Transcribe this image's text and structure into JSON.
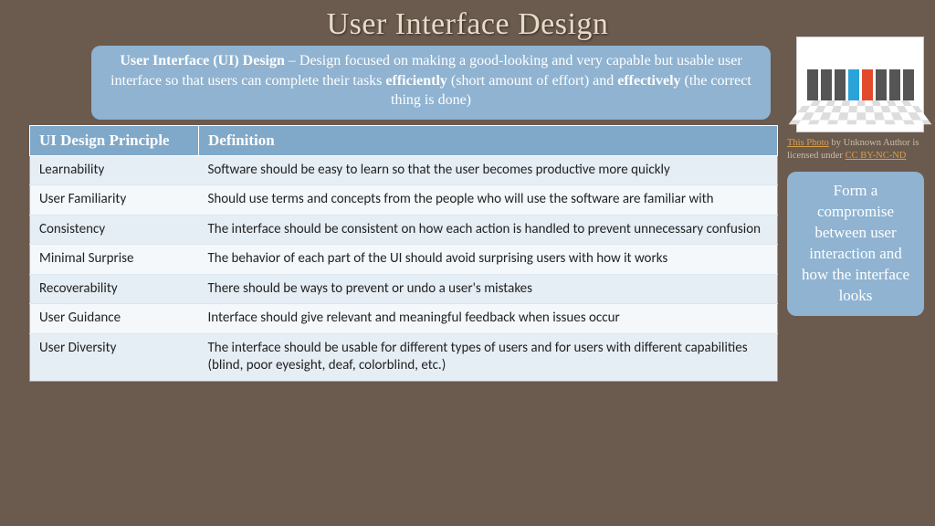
{
  "title": "User Interface Design",
  "intro": {
    "lead_bold": "User Interface (UI) Design",
    "line1_rest": " – Design focused on making a good-looking and very capable but usable user interface so that users can complete their tasks ",
    "eff1": "efficiently",
    "line2_mid": " (short amount of effort) and ",
    "eff2": "effectively",
    "line2_end": " (the correct thing is done)"
  },
  "table": {
    "header_principle": "UI Design Principle",
    "header_definition": "Definition",
    "rows": [
      {
        "principle": "Learnability",
        "definition": "Software should be easy to learn so that the user becomes productive more quickly"
      },
      {
        "principle": "User Familiarity",
        "definition": "Should use terms and concepts from the people who will use the software are familiar with"
      },
      {
        "principle": "Consistency",
        "definition": "The interface should be consistent on how each action is handled to prevent unnecessary confusion"
      },
      {
        "principle": "Minimal Surprise",
        "definition": "The behavior of each part of the UI should avoid surprising users with how it works"
      },
      {
        "principle": "Recoverability",
        "definition": "There should be ways to prevent or undo a user's mistakes"
      },
      {
        "principle": "User Guidance",
        "definition": "Interface should give relevant and meaningful feedback when issues occur"
      },
      {
        "principle": "User Diversity",
        "definition": "The interface should be usable for different types of users and for users with different capabilities (blind, poor eyesight, deaf, colorblind, etc.)"
      }
    ]
  },
  "attribution": {
    "link1": "This Photo",
    "mid": " by Unknown Author is licensed under ",
    "link2": "CC BY-NC-ND"
  },
  "side_note": "Form a compromise between user interaction and how the interface looks"
}
